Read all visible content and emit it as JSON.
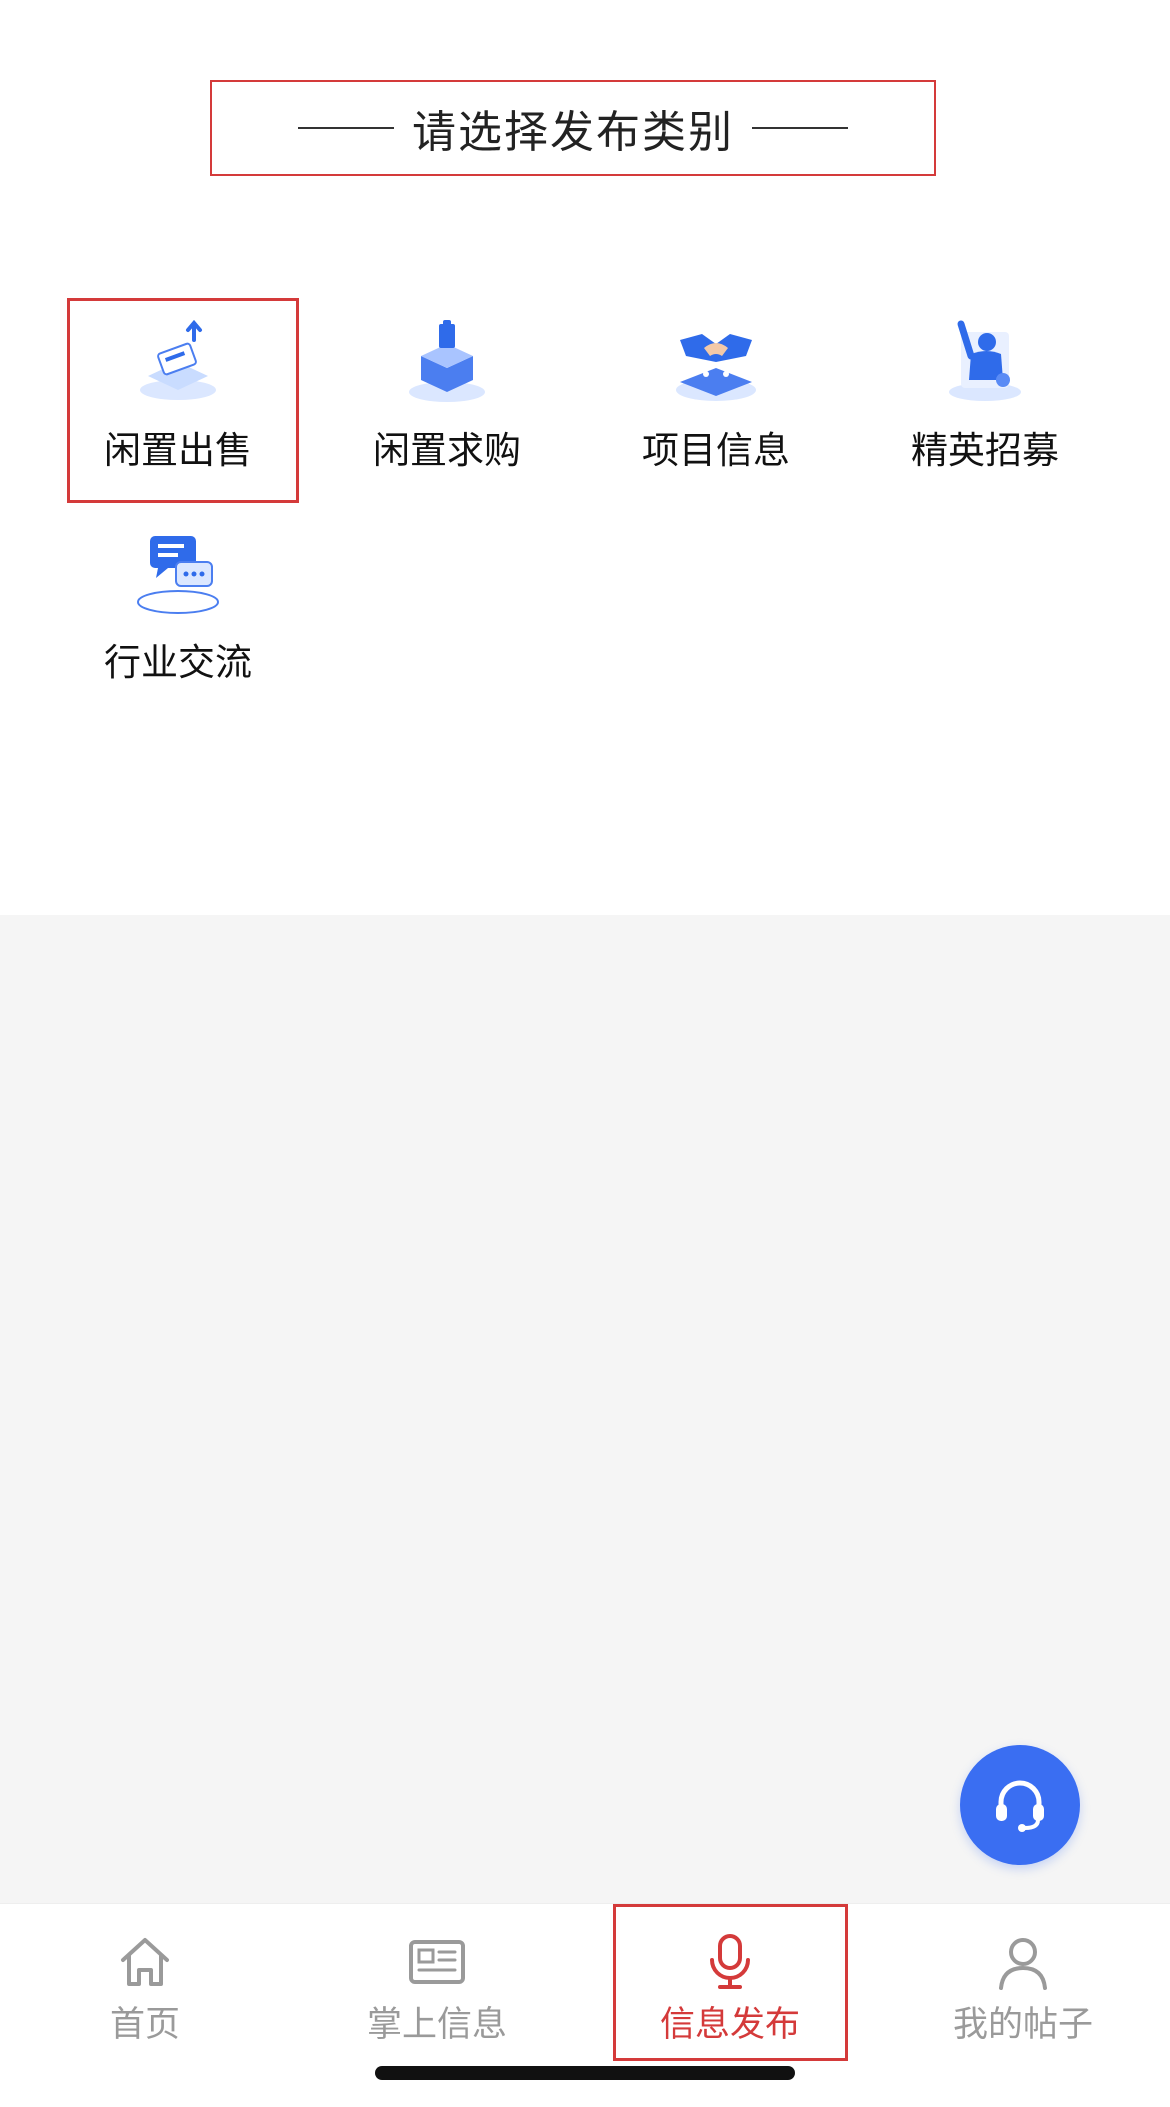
{
  "header": {
    "title": "请选择发布类别"
  },
  "categories": [
    {
      "label": "闲置出售",
      "icon": "price-tag-upload-icon"
    },
    {
      "label": "闲置求购",
      "icon": "open-box-icon"
    },
    {
      "label": "项目信息",
      "icon": "handshake-icon"
    },
    {
      "label": "精英招募",
      "icon": "person-raising-hand-icon"
    },
    {
      "label": "行业交流",
      "icon": "chat-bubbles-icon"
    }
  ],
  "bottom_nav": [
    {
      "label": "首页",
      "icon": "home-icon",
      "active": false
    },
    {
      "label": "掌上信息",
      "icon": "newspaper-icon",
      "active": false
    },
    {
      "label": "信息发布",
      "icon": "microphone-icon",
      "active": true
    },
    {
      "label": "我的帖子",
      "icon": "user-icon",
      "active": false
    }
  ],
  "colors": {
    "accent": "#d43a3a",
    "fab": "#3a6ef2",
    "icon_blue": "#2f6bea",
    "nav_inactive": "#9a9a9a"
  },
  "support_button": {
    "icon": "headset-icon"
  }
}
